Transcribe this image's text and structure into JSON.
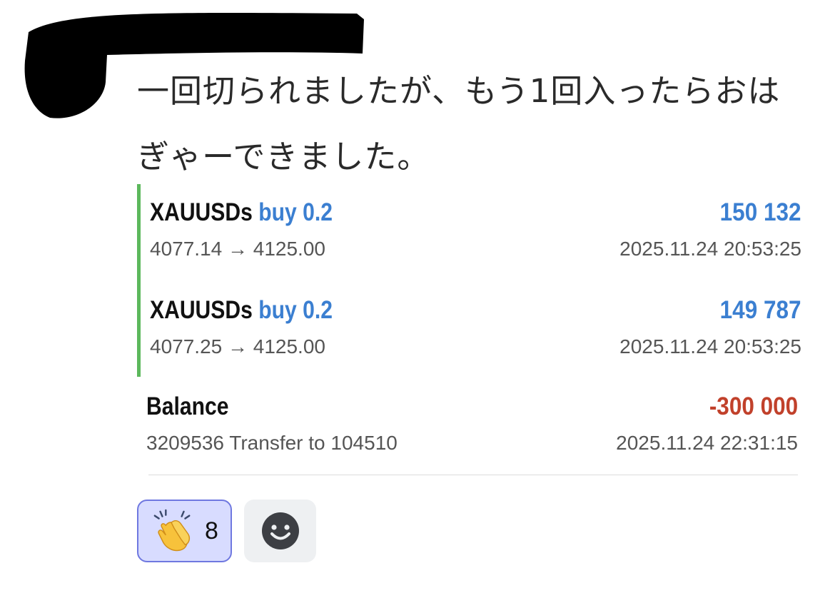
{
  "message": {
    "line1": "一回切られましたが、もう1回入ったらおは",
    "line2": "ぎゃーできました。"
  },
  "trades": [
    {
      "symbol": "XAUUSDs",
      "side": "buy 0.2",
      "profit": "150 132",
      "prices": "4077.14 → 4125.00",
      "time": "2025.11.24 20:53:25"
    },
    {
      "symbol": "XAUUSDs",
      "side": "buy 0.2",
      "profit": "149 787",
      "prices": "4077.25 → 4125.00",
      "time": "2025.11.24 20:53:25"
    }
  ],
  "balance": {
    "label": "Balance",
    "amount": "-300 000",
    "comment": "3209536 Transfer to 104510",
    "time": "2025.11.24 22:31:15"
  },
  "reactions": {
    "clap": {
      "icon": "clapping-hands-icon",
      "count": "8"
    },
    "add": {
      "icon": "smiley-add-reaction-icon"
    }
  },
  "colors": {
    "buy_accent": "#3b7fd1",
    "negative": "#c1412b",
    "group_bar": "#5cb85c",
    "reaction_selected_bg": "#d8dcff",
    "reaction_selected_border": "#6f78e0"
  }
}
